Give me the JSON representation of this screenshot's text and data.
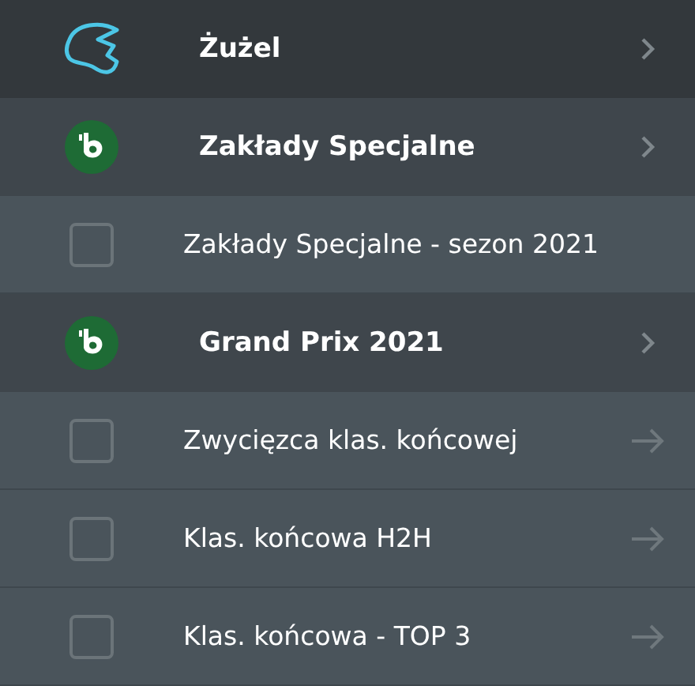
{
  "rows": [
    {
      "kind": "sport",
      "label": "Żużel",
      "has_arrow": true
    },
    {
      "kind": "group",
      "label": "Zakłady Specjalne",
      "has_arrow": true
    },
    {
      "kind": "market",
      "label": "Zakłady Specjalne - sezon 2021",
      "checked": false,
      "has_arrow": false
    },
    {
      "kind": "group",
      "label": "Grand Prix 2021",
      "has_arrow": true
    },
    {
      "kind": "market",
      "label": "Zwycięzca klas. końcowej",
      "checked": false,
      "has_arrow": true
    },
    {
      "kind": "market",
      "label": "Klas. końcowa H2H",
      "checked": false,
      "has_arrow": true
    },
    {
      "kind": "market",
      "label": "Klas. końcowa - TOP 3",
      "checked": false,
      "has_arrow": true
    }
  ]
}
